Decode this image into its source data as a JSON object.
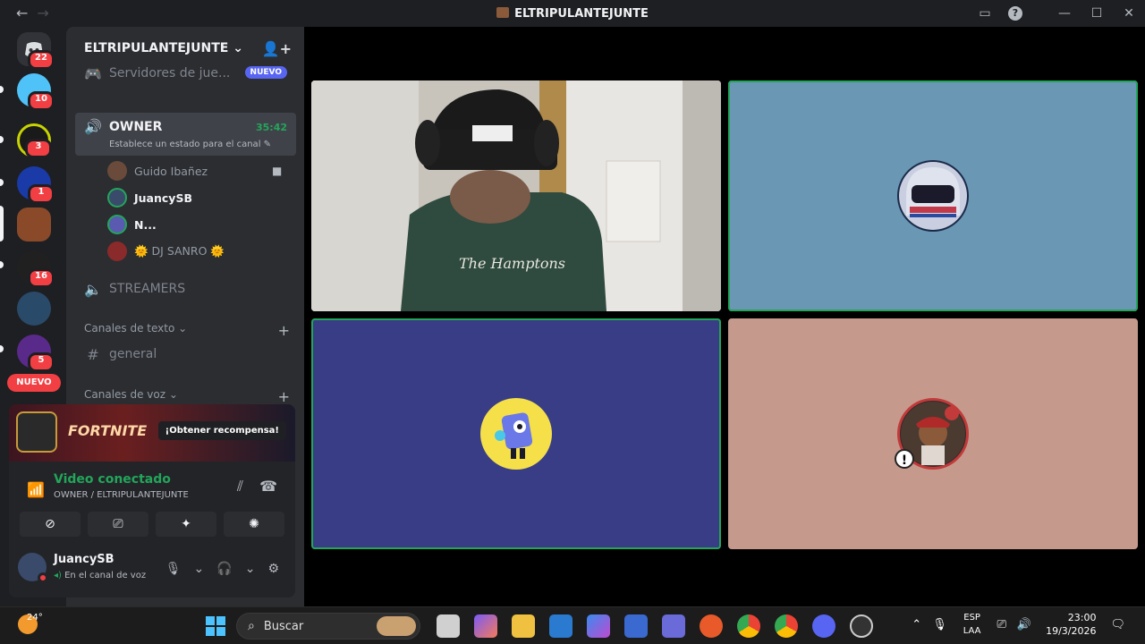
{
  "window": {
    "title": "ELTRIPULANTEJUNTE",
    "back": "←",
    "forward": "→",
    "help": "?",
    "min": "—",
    "max": "☐",
    "close": "✕"
  },
  "rail": {
    "servers": [
      {
        "name": "direct-messages",
        "badge": "22",
        "color": "#5865f2"
      },
      {
        "name": "server-blue",
        "badge": "10",
        "color": "#4fc3f7"
      },
      {
        "name": "server-yellow",
        "badge": "3",
        "color": "#c8d400"
      },
      {
        "name": "server-stars",
        "badge": "1",
        "color": "#1a3aa8"
      },
      {
        "name": "server-eltripulantejunte",
        "badge": "",
        "color": "#8a4a2a"
      },
      {
        "name": "server-black",
        "badge": "16",
        "color": "#202020"
      },
      {
        "name": "server-eagles",
        "badge": "",
        "color": "#2a4a6a"
      },
      {
        "name": "server-chilena",
        "badge": "5",
        "color": "#5a2a8a"
      }
    ],
    "nuevo": "NUEVO"
  },
  "sidebar": {
    "server_name": "ELTRIPULANTEJUNTE",
    "chevron": "⌄",
    "games_row": {
      "label": "Servidores de jue...",
      "badge": "NUEVO"
    },
    "owner": {
      "name": "OWNER",
      "timer": "35:42",
      "status": "Establece un estado para el canal"
    },
    "users": [
      {
        "name": "Guido Ibañez",
        "color": "#6a4a3a"
      },
      {
        "name": "JuancySB",
        "color": "#3a4a6a"
      },
      {
        "name": "N...",
        "color": "#5a5ab0"
      },
      {
        "name": "🌞 DJ SANRO 🌞",
        "color": "#8a2a2a"
      }
    ],
    "streamers": "STREAMERS",
    "text_category": "Canales de texto",
    "general": "general",
    "voice_category": "Canales de voz",
    "plus": "+",
    "hash": "#"
  },
  "promo": {
    "game": "FORTNITE",
    "cta": "¡Obtener recompensa!"
  },
  "voice": {
    "title": "Video conectado",
    "subtitle": "OWNER / ELTRIPULANTEJUNTE"
  },
  "user": {
    "name": "JuancySB",
    "status": "En el canal de voz"
  },
  "taskbar": {
    "temp": "24°",
    "search": "Buscar",
    "lang_top": "ESP",
    "lang_bottom": "LAA",
    "time": "23:00",
    "date": "19/3/2026"
  },
  "tiles": [
    {
      "name": "camera-feed",
      "bg": "#9a9a98"
    },
    {
      "name": "helmet-avatar-tile",
      "bg": "#6a97b4"
    },
    {
      "name": "robot-avatar-tile",
      "bg": "#393d86"
    },
    {
      "name": "bear-avatar-tile",
      "bg": "#c59a8c"
    }
  ]
}
